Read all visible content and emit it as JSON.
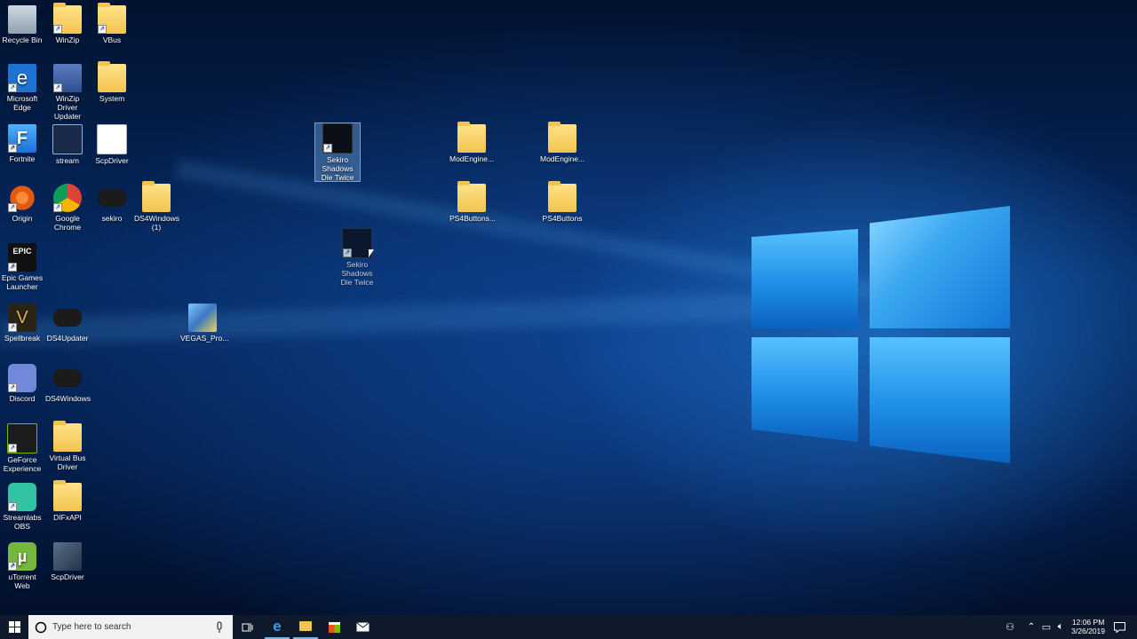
{
  "desktop": {
    "icons": [
      {
        "label": "Recycle Bin",
        "icon": "recycle-bin-icon"
      },
      {
        "label": "WinZip",
        "icon": "winzip-icon"
      },
      {
        "label": "VBus",
        "icon": "folder-icon"
      },
      {
        "label": "Microsoft Edge",
        "icon": "edge-icon"
      },
      {
        "label": "WinZip Driver Updater",
        "icon": "winzip-driver-updater-icon"
      },
      {
        "label": "System",
        "icon": "folder-icon"
      },
      {
        "label": "Fortnite",
        "icon": "fortnite-icon"
      },
      {
        "label": "stream",
        "icon": "stream-icon"
      },
      {
        "label": "ScpDriver",
        "icon": "document-icon"
      },
      {
        "label": "Origin",
        "icon": "origin-icon"
      },
      {
        "label": "Google Chrome",
        "icon": "chrome-icon"
      },
      {
        "label": "sekiro",
        "icon": "gamepad-icon"
      },
      {
        "label": "DS4Windows (1)",
        "icon": "zip-folder-icon"
      },
      {
        "label": "Epic Games Launcher",
        "icon": "epic-games-icon"
      },
      {
        "label": "Spellbreak",
        "icon": "spellbreak-icon"
      },
      {
        "label": "DS4Updater",
        "icon": "gamepad-icon"
      },
      {
        "label": "VEGAS_Pro...",
        "icon": "installer-icon"
      },
      {
        "label": "Discord",
        "icon": "discord-icon"
      },
      {
        "label": "DS4Windows",
        "icon": "gamepad-icon"
      },
      {
        "label": "GeForce Experience",
        "icon": "geforce-icon"
      },
      {
        "label": "Virtual Bus Driver",
        "icon": "folder-icon"
      },
      {
        "label": "Streamlabs OBS",
        "icon": "streamlabs-icon"
      },
      {
        "label": "DIFxAPI",
        "icon": "folder-icon"
      },
      {
        "label": "uTorrent Web",
        "icon": "utorrent-icon"
      },
      {
        "label": "ScpDriver",
        "icon": "scpdriver-app-icon"
      },
      {
        "label": "Sekiro Shadows Die Twice",
        "icon": "sekiro-icon"
      },
      {
        "label": "Sekiro Shadows Die Twice",
        "icon": "sekiro-icon"
      },
      {
        "label": "ModEngine...",
        "icon": "zip-folder-icon"
      },
      {
        "label": "ModEngine...",
        "icon": "folder-icon"
      },
      {
        "label": "PS4Buttons...",
        "icon": "zip-folder-icon"
      },
      {
        "label": "PS4Buttons",
        "icon": "folder-icon"
      }
    ]
  },
  "taskbar": {
    "search_placeholder": "Type here to search",
    "time": "12:06 PM",
    "date": "3/26/2019"
  },
  "colors": {
    "taskbar": "#0e1a2b",
    "accent": "#1f8fe6"
  }
}
